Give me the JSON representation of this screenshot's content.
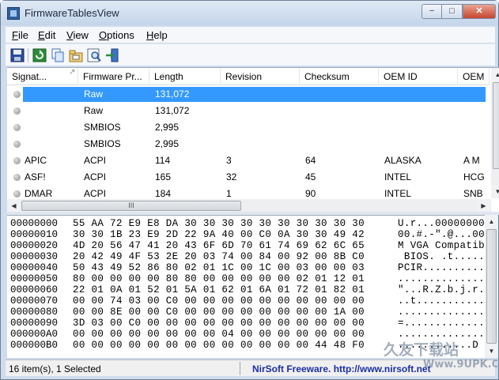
{
  "window": {
    "title": "FirmwareTablesView"
  },
  "titlebar_buttons": {
    "minimize": "−",
    "maximize": "□",
    "close": "✕"
  },
  "menu": [
    {
      "label": "File",
      "key": "F",
      "rest": "ile"
    },
    {
      "label": "Edit",
      "key": "E",
      "rest": "dit"
    },
    {
      "label": "View",
      "key": "V",
      "rest": "iew"
    },
    {
      "label": "Options",
      "key": "O",
      "rest": "ptions"
    },
    {
      "label": "Help",
      "key": "H",
      "rest": "elp"
    }
  ],
  "toolbar": [
    "save-icon",
    "refresh-icon",
    "copy-icon",
    "properties-icon",
    "find-icon",
    "exit-icon"
  ],
  "columns": [
    "Signat...",
    "Firmware Pr...",
    "Length",
    "Revision",
    "Checksum",
    "OEM ID",
    "OEM"
  ],
  "rows": [
    {
      "cells": [
        "",
        "Raw",
        "131,072",
        "",
        "",
        "",
        ""
      ],
      "selected": true
    },
    {
      "cells": [
        "",
        "Raw",
        "131,072",
        "",
        "",
        "",
        ""
      ],
      "selected": false
    },
    {
      "cells": [
        "",
        "SMBIOS",
        "2,995",
        "",
        "",
        "",
        ""
      ],
      "selected": false
    },
    {
      "cells": [
        "",
        "SMBIOS",
        "2,995",
        "",
        "",
        "",
        ""
      ],
      "selected": false
    },
    {
      "cells": [
        "APIC",
        "ACPI",
        "114",
        "3",
        "64",
        "ALASKA",
        "A M"
      ],
      "selected": false
    },
    {
      "cells": [
        "ASF!",
        "ACPI",
        "165",
        "32",
        "45",
        "INTEL",
        "HCG"
      ],
      "selected": false
    },
    {
      "cells": [
        "DMAR",
        "ACPI",
        "184",
        "1",
        "90",
        "INTEL",
        "SNB"
      ],
      "selected": false
    }
  ],
  "hscroll_thumb_label": "III",
  "hex": [
    {
      "off": "00000000",
      "bytes": "55 AA 72 E9 E8 DA 30 30 30 30 30 30 30 30 30 30",
      "ascii": "U.r...00000000"
    },
    {
      "off": "00000010",
      "bytes": "30 30 1B 23 E9 2D 22 9A 40 00 C0 0A 30 30 49 42",
      "ascii": "00.#.-\".@...00"
    },
    {
      "off": "00000020",
      "bytes": "4D 20 56 47 41 20 43 6F 6D 70 61 74 69 62 6C 65",
      "ascii": "M VGA Compatib"
    },
    {
      "off": "00000030",
      "bytes": "20 42 49 4F 53 2E 20 03 74 00 84 00 92 00 8B C0",
      "ascii": " BIOS. .t....."
    },
    {
      "off": "00000040",
      "bytes": "50 43 49 52 86 80 02 01 1C 00 1C 00 03 00 00 03",
      "ascii": "PCIR.........."
    },
    {
      "off": "00000050",
      "bytes": "80 00 00 00 00 80 80 00 00 00 00 00 02 01 12 01",
      "ascii": ".............."
    },
    {
      "off": "00000060",
      "bytes": "22 01 0A 01 52 01 5A 01 62 01 6A 01 72 01 82 01",
      "ascii": "\"...R.Z.b.j.r."
    },
    {
      "off": "00000070",
      "bytes": "00 00 74 03 00 C0 00 00 00 00 00 00 00 00 00 00",
      "ascii": "..t..........."
    },
    {
      "off": "00000080",
      "bytes": "00 00 8E 00 00 C0 00 00 00 00 00 00 00 00 1A 00",
      "ascii": ".............."
    },
    {
      "off": "00000090",
      "bytes": "3D 03 00 C0 00 00 00 00 00 00 00 00 00 00 00 00",
      "ascii": "=............."
    },
    {
      "off": "000000A0",
      "bytes": "00 00 00 00 00 00 00 00 04 00 00 00 00 00 00 00",
      "ascii": ".............."
    },
    {
      "off": "000000B0",
      "bytes": "00 00 00 00 00 00 00 00 00 00 00 00 00 44 48 F0",
      "ascii": "............D"
    }
  ],
  "status": {
    "count": "16 item(s), 1 Selected",
    "link": "NirSoft Freeware.  http://www.nirsoft.net"
  },
  "watermark": {
    "text_top": "久友下载站",
    "text_bottom": "Www.9UPK.Com"
  },
  "colors": {
    "selection": "#3399ff",
    "link": "#1a2ea3"
  }
}
